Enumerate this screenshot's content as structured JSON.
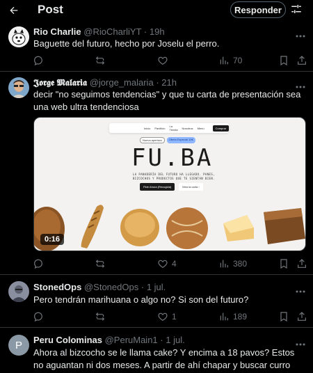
{
  "header": {
    "title": "Post",
    "reply_button": "Responder"
  },
  "posts": [
    {
      "name": "Rio Charlie",
      "handle": "@RioCharliYT",
      "dot": "·",
      "time": "19h",
      "text": "Baguette del futuro, hecho por Joselu el perro.",
      "stats": {
        "replies": "",
        "reposts": "",
        "likes": "",
        "views": "70"
      }
    },
    {
      "name": "𝕵𝖔𝖗𝖌𝖊 𝕸𝖆𝖑𝖆𝖗𝖎𝖆",
      "handle": "@jorge_malaria",
      "dot": "·",
      "time": "21h",
      "text": "decir \"no seguimos tendencias\" y que tu carta de presentación sea una web ultra tendenciosa",
      "stats": {
        "replies": "",
        "reposts": "",
        "likes": "4",
        "views": "380"
      },
      "media": {
        "duration": "0:16",
        "site": {
          "nav": [
            "Inicio",
            "Panificio",
            "La Tienda",
            "Nosotros",
            "Menú"
          ],
          "nav_cta": "Comprar",
          "pill_1": "Nueva apertura",
          "pill_2": "Oferta Especial 10€",
          "brand": "FU.BA",
          "tagline": "LA PANADERÍA DEL FUTURO HA LLEGADO. PANES, BIZCOCHOS Y PRODUCTOS QUE TE SIENTAN BIEN.",
          "cta_primary": "Pide Ahora (Recogida)",
          "cta_secondary": "Mira la carta ›"
        }
      }
    },
    {
      "name": "StonedOps",
      "handle": "@StonedOps",
      "dot": "·",
      "time": "1 jul.",
      "text": "Pero tendrán marihuana o algo no? Si son del futuro?",
      "stats": {
        "replies": "",
        "reposts": "",
        "likes": "1",
        "views": "189"
      }
    },
    {
      "name": "Peru Colominas",
      "handle": "@PeruMain1",
      "dot": "·",
      "time": "1 jul.",
      "avatar_letter": "P",
      "text": "Ahora al bizcocho se le llama cake? Y encima a 18 pavos? Estos no aguantan ni dos meses. A partir de ahí chapar y buscar curro"
    }
  ],
  "colors": {
    "background": "#000000",
    "text": "#e7e9ea",
    "muted": "#71767b",
    "divider": "#2f3336"
  }
}
